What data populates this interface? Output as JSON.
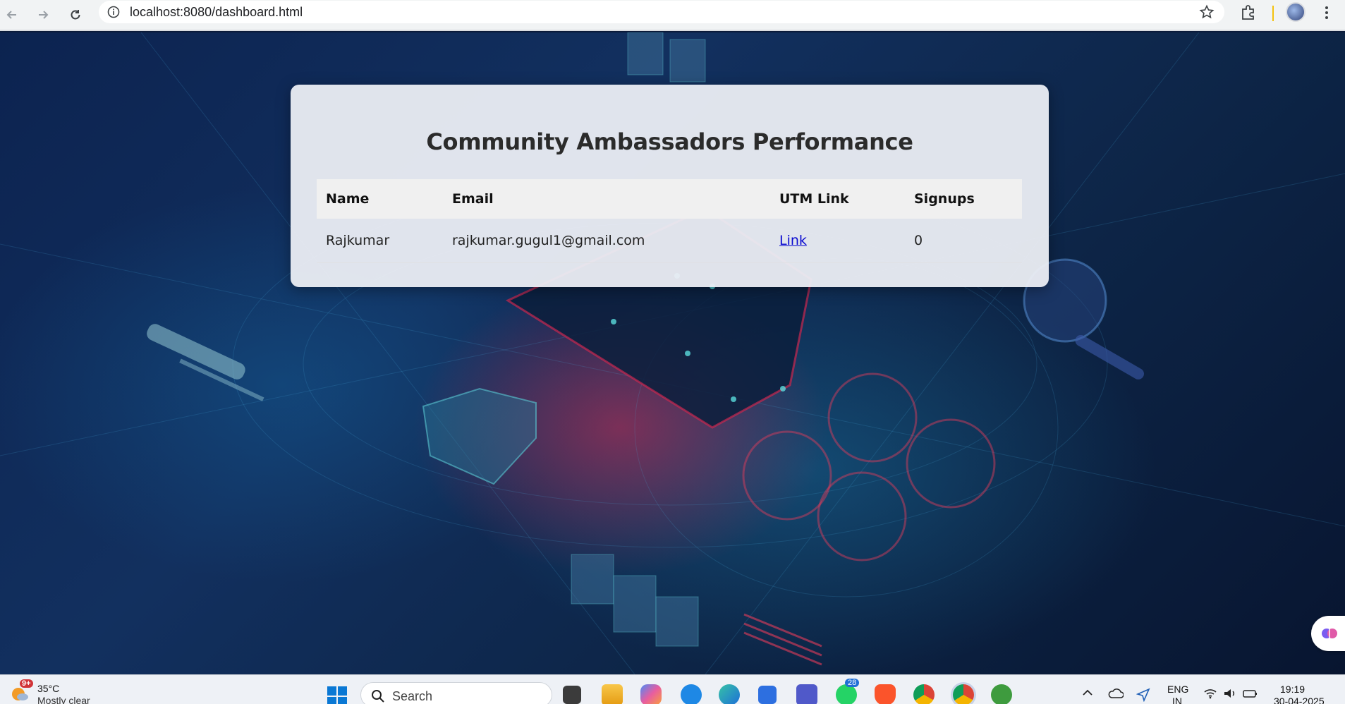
{
  "browser": {
    "url_text": "localhost:8080/dashboard.html"
  },
  "dashboard": {
    "title": "Community Ambassadors Performance",
    "table": {
      "headers": [
        "Name",
        "Email",
        "UTM Link",
        "Signups"
      ],
      "rows": [
        {
          "name": "Rajkumar",
          "email": "rajkumar.gugul1@gmail.com",
          "utm_link_label": "Link",
          "signups": "0"
        }
      ]
    }
  },
  "taskbar": {
    "weather_badge": "9+",
    "weather_temp": "35°C",
    "weather_desc": "Mostly clear",
    "search_label": "Search",
    "whatsapp_badge": "28",
    "language_line1": "ENG",
    "language_line2": "IN",
    "time": "19:19",
    "date": "30-04-2025"
  },
  "colors": {
    "link": "#0b0bd0",
    "card_bg": "#eceef4",
    "taskbar_bg": "#eef1f6"
  }
}
